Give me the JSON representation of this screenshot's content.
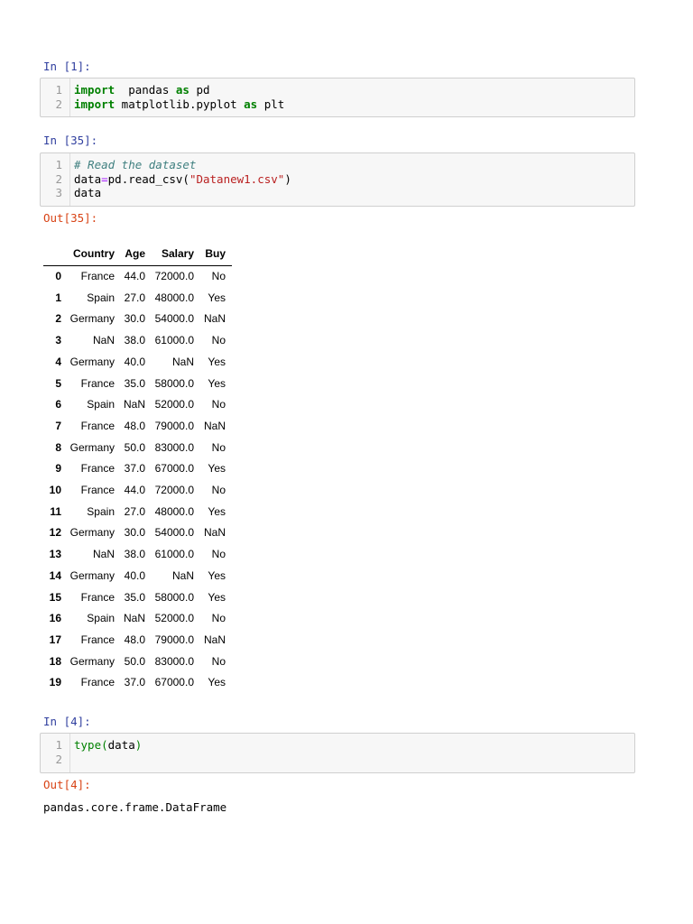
{
  "cells": [
    {
      "prompt": "In [1]:",
      "lines": [
        {
          "n": "1",
          "tokens": [
            [
              "kw",
              "import"
            ],
            [
              "",
              "  pandas "
            ],
            [
              "kw",
              "as"
            ],
            [
              "",
              " pd"
            ]
          ]
        },
        {
          "n": "2",
          "tokens": [
            [
              "kw",
              "import"
            ],
            [
              "",
              " matplotlib.pyplot "
            ],
            [
              "kw",
              "as"
            ],
            [
              "",
              " plt"
            ]
          ]
        }
      ]
    },
    {
      "prompt": "In [35]:",
      "lines": [
        {
          "n": "1",
          "tokens": [
            [
              "cm",
              "# Read the dataset"
            ]
          ]
        },
        {
          "n": "2",
          "tokens": [
            [
              "",
              "data"
            ],
            [
              "op",
              "="
            ],
            [
              "",
              "pd.read_csv("
            ],
            [
              "st",
              "\"Datanew1.csv\""
            ],
            [
              "",
              ")"
            ]
          ]
        },
        {
          "n": "3",
          "tokens": [
            [
              "",
              "data"
            ]
          ]
        }
      ],
      "out_prompt": "Out[35]:"
    },
    {
      "prompt": "In [4]:",
      "lines": [
        {
          "n": "1",
          "tokens": [
            [
              "bi",
              "type("
            ],
            [
              "",
              "data"
            ],
            [
              "bi",
              ")"
            ]
          ]
        },
        {
          "n": "2",
          "tokens": []
        }
      ],
      "out_prompt": "Out[4]:",
      "output_text": "pandas.core.frame.DataFrame"
    }
  ],
  "table": {
    "columns": [
      "Country",
      "Age",
      "Salary",
      "Buy"
    ],
    "rows": [
      [
        "0",
        "France",
        "44.0",
        "72000.0",
        "No"
      ],
      [
        "1",
        "Spain",
        "27.0",
        "48000.0",
        "Yes"
      ],
      [
        "2",
        "Germany",
        "30.0",
        "54000.0",
        "NaN"
      ],
      [
        "3",
        "NaN",
        "38.0",
        "61000.0",
        "No"
      ],
      [
        "4",
        "Germany",
        "40.0",
        "NaN",
        "Yes"
      ],
      [
        "5",
        "France",
        "35.0",
        "58000.0",
        "Yes"
      ],
      [
        "6",
        "Spain",
        "NaN",
        "52000.0",
        "No"
      ],
      [
        "7",
        "France",
        "48.0",
        "79000.0",
        "NaN"
      ],
      [
        "8",
        "Germany",
        "50.0",
        "83000.0",
        "No"
      ],
      [
        "9",
        "France",
        "37.0",
        "67000.0",
        "Yes"
      ],
      [
        "10",
        "France",
        "44.0",
        "72000.0",
        "No"
      ],
      [
        "11",
        "Spain",
        "27.0",
        "48000.0",
        "Yes"
      ],
      [
        "12",
        "Germany",
        "30.0",
        "54000.0",
        "NaN"
      ],
      [
        "13",
        "NaN",
        "38.0",
        "61000.0",
        "No"
      ],
      [
        "14",
        "Germany",
        "40.0",
        "NaN",
        "Yes"
      ],
      [
        "15",
        "France",
        "35.0",
        "58000.0",
        "Yes"
      ],
      [
        "16",
        "Spain",
        "NaN",
        "52000.0",
        "No"
      ],
      [
        "17",
        "France",
        "48.0",
        "79000.0",
        "NaN"
      ],
      [
        "18",
        "Germany",
        "50.0",
        "83000.0",
        "No"
      ],
      [
        "19",
        "France",
        "37.0",
        "67000.0",
        "Yes"
      ]
    ]
  }
}
